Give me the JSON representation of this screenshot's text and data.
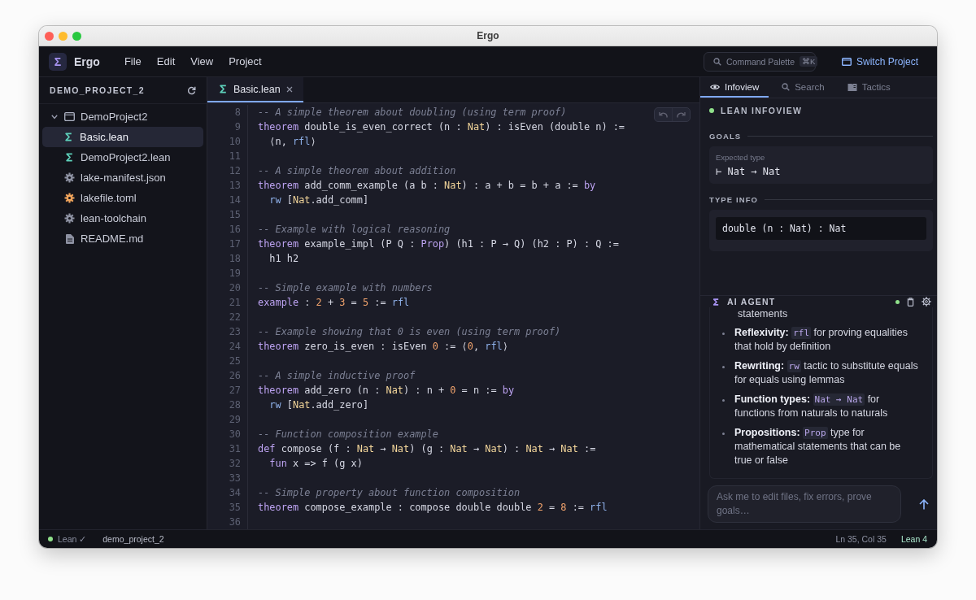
{
  "window": {
    "title": "Ergo"
  },
  "app_bar": {
    "logo": "Σ",
    "app_name": "Ergo",
    "menu": [
      "File",
      "Edit",
      "View",
      "Project"
    ],
    "command_palette": {
      "placeholder": "Command Palette",
      "shortcut": "⌘K"
    },
    "switch_project": "Switch Project"
  },
  "explorer": {
    "title": "DEMO_PROJECT_2",
    "items": [
      {
        "label": "DemoProject2",
        "kind": "folder",
        "expanded": true,
        "selected": false,
        "children": [
          {
            "label": "Basic.lean",
            "kind": "lean",
            "selected": true
          }
        ]
      },
      {
        "label": "DemoProject2.lean",
        "kind": "lean",
        "selected": false
      },
      {
        "label": "lake-manifest.json",
        "kind": "config",
        "selected": false
      },
      {
        "label": "lakefile.toml",
        "kind": "toml",
        "selected": false
      },
      {
        "label": "lean-toolchain",
        "kind": "config",
        "selected": false
      },
      {
        "label": "README.md",
        "kind": "document",
        "selected": false
      }
    ]
  },
  "editor": {
    "tabs": [
      {
        "label": "Basic.lean",
        "selected": true
      }
    ],
    "undo": {
      "disabled": true
    },
    "redo": {
      "disabled": true
    },
    "lines": [
      {
        "number": "8",
        "indented": false,
        "tokens": [
          {
            "kind": "comment",
            "text": "-- A simple theorem about doubling (using term proof)"
          }
        ]
      },
      {
        "number": "9",
        "indented": false,
        "tokens": [
          {
            "kind": "keyword",
            "text": "theorem"
          },
          {
            "kind": "plain",
            "text": " double_is_even_correct (n : "
          },
          {
            "kind": "type",
            "text": "Nat"
          },
          {
            "kind": "plain",
            "text": ") : isEven (double n) :="
          }
        ]
      },
      {
        "number": "10",
        "indented": true,
        "tokens": [
          {
            "kind": "plain",
            "text": "⟨n, "
          },
          {
            "kind": "tactic",
            "text": "rfl"
          },
          {
            "kind": "plain",
            "text": "⟩"
          }
        ]
      },
      {
        "number": "11"
      },
      {
        "number": "12",
        "indented": false,
        "tokens": [
          {
            "kind": "comment",
            "text": "-- A simple theorem about addition"
          }
        ]
      },
      {
        "number": "13",
        "indented": false,
        "tokens": [
          {
            "kind": "keyword",
            "text": "theorem"
          },
          {
            "kind": "plain",
            "text": " add_comm_example (a b : "
          },
          {
            "kind": "type",
            "text": "Nat"
          },
          {
            "kind": "plain",
            "text": ") : a + b = b + a := "
          },
          {
            "kind": "keyword",
            "text": "by"
          }
        ]
      },
      {
        "number": "14",
        "indented": true,
        "tokens": [
          {
            "kind": "tactic",
            "text": "rw"
          },
          {
            "kind": "plain",
            "text": " ["
          },
          {
            "kind": "type",
            "text": "Nat"
          },
          {
            "kind": "plain",
            "text": ".add_comm]"
          }
        ]
      },
      {
        "number": "15"
      },
      {
        "number": "16",
        "indented": false,
        "tokens": [
          {
            "kind": "comment",
            "text": "-- Example with logical reasoning"
          }
        ]
      },
      {
        "number": "17",
        "indented": false,
        "tokens": [
          {
            "kind": "keyword",
            "text": "theorem"
          },
          {
            "kind": "plain",
            "text": " example_impl (P Q : "
          },
          {
            "kind": "keyword",
            "text": "Prop"
          },
          {
            "kind": "plain",
            "text": ") (h1 : P → Q) (h2 : P) : Q :="
          }
        ]
      },
      {
        "number": "18",
        "indented": true,
        "tokens": [
          {
            "kind": "plain",
            "text": "h1 h2"
          }
        ]
      },
      {
        "number": "19"
      },
      {
        "number": "20",
        "indented": false,
        "tokens": [
          {
            "kind": "comment",
            "text": "-- Simple example with numbers"
          }
        ]
      },
      {
        "number": "21",
        "indented": false,
        "tokens": [
          {
            "kind": "keyword",
            "text": "example"
          },
          {
            "kind": "plain",
            "text": " : "
          },
          {
            "kind": "number",
            "text": "2"
          },
          {
            "kind": "plain",
            "text": " + "
          },
          {
            "kind": "number",
            "text": "3"
          },
          {
            "kind": "plain",
            "text": " = "
          },
          {
            "kind": "number",
            "text": "5"
          },
          {
            "kind": "plain",
            "text": " := "
          },
          {
            "kind": "tactic",
            "text": "rfl"
          }
        ]
      },
      {
        "number": "22"
      },
      {
        "number": "23",
        "indented": false,
        "tokens": [
          {
            "kind": "comment",
            "text": "-- Example showing that 0 is even (using term proof)"
          }
        ]
      },
      {
        "number": "24",
        "indented": false,
        "tokens": [
          {
            "kind": "keyword",
            "text": "theorem"
          },
          {
            "kind": "plain",
            "text": " zero_is_even : isEven "
          },
          {
            "kind": "number",
            "text": "0"
          },
          {
            "kind": "plain",
            "text": " := ⟨"
          },
          {
            "kind": "number",
            "text": "0"
          },
          {
            "kind": "plain",
            "text": ", "
          },
          {
            "kind": "tactic",
            "text": "rfl"
          },
          {
            "kind": "plain",
            "text": "⟩"
          }
        ]
      },
      {
        "number": "25"
      },
      {
        "number": "26",
        "indented": false,
        "tokens": [
          {
            "kind": "comment",
            "text": "-- A simple inductive proof"
          }
        ]
      },
      {
        "number": "27",
        "indented": false,
        "tokens": [
          {
            "kind": "keyword",
            "text": "theorem"
          },
          {
            "kind": "plain",
            "text": " add_zero (n : "
          },
          {
            "kind": "type",
            "text": "Nat"
          },
          {
            "kind": "plain",
            "text": ") : n + "
          },
          {
            "kind": "number",
            "text": "0"
          },
          {
            "kind": "plain",
            "text": " = n := "
          },
          {
            "kind": "keyword",
            "text": "by"
          }
        ]
      },
      {
        "number": "28",
        "indented": true,
        "tokens": [
          {
            "kind": "tactic",
            "text": "rw"
          },
          {
            "kind": "plain",
            "text": " ["
          },
          {
            "kind": "type",
            "text": "Nat"
          },
          {
            "kind": "plain",
            "text": ".add_zero]"
          }
        ]
      },
      {
        "number": "29"
      },
      {
        "number": "30",
        "indented": false,
        "tokens": [
          {
            "kind": "comment",
            "text": "-- Function composition example"
          }
        ]
      },
      {
        "number": "31",
        "indented": false,
        "tokens": [
          {
            "kind": "keyword",
            "text": "def"
          },
          {
            "kind": "plain",
            "text": " compose (f : "
          },
          {
            "kind": "type",
            "text": "Nat"
          },
          {
            "kind": "plain",
            "text": " → "
          },
          {
            "kind": "type",
            "text": "Nat"
          },
          {
            "kind": "plain",
            "text": ") (g : "
          },
          {
            "kind": "type",
            "text": "Nat"
          },
          {
            "kind": "plain",
            "text": " → "
          },
          {
            "kind": "type",
            "text": "Nat"
          },
          {
            "kind": "plain",
            "text": ") : "
          },
          {
            "kind": "type",
            "text": "Nat"
          },
          {
            "kind": "plain",
            "text": " → "
          },
          {
            "kind": "type",
            "text": "Nat"
          },
          {
            "kind": "plain",
            "text": " :="
          }
        ]
      },
      {
        "number": "32",
        "indented": true,
        "tokens": [
          {
            "kind": "keyword",
            "text": "fun"
          },
          {
            "kind": "plain",
            "text": " x => f (g x)"
          }
        ]
      },
      {
        "number": "33"
      },
      {
        "number": "34",
        "indented": false,
        "tokens": [
          {
            "kind": "comment",
            "text": "-- Simple property about function composition"
          }
        ]
      },
      {
        "number": "35",
        "indented": false,
        "tokens": [
          {
            "kind": "keyword",
            "text": "theorem"
          },
          {
            "kind": "plain",
            "text": " compose_example : compose double double "
          },
          {
            "kind": "number",
            "text": "2"
          },
          {
            "kind": "plain",
            "text": " = "
          },
          {
            "kind": "number",
            "text": "8"
          },
          {
            "kind": "plain",
            "text": " := "
          },
          {
            "kind": "tactic",
            "text": "rfl"
          }
        ]
      },
      {
        "number": "36"
      }
    ]
  },
  "infoview": {
    "tabs": [
      {
        "label": "Infoview",
        "selected": true
      },
      {
        "label": "Search",
        "selected": false
      },
      {
        "label": "Tactics",
        "selected": false
      }
    ],
    "title": "LEAN INFOVIEW",
    "connected": true,
    "goals": {
      "heading": "GOALS",
      "label": "Expected type",
      "goal": "⊢ Nat → Nat"
    },
    "type_info": {
      "heading": "TYPE INFO",
      "value": "double (n : Nat) : Nat"
    }
  },
  "ai_agent": {
    "title": "AI AGENT",
    "online": true,
    "message_start": "statements",
    "bullets": [
      {
        "term": "Reflexivity:",
        "code": "rfl",
        "text": "for proving equalities that hold by definition"
      },
      {
        "term": "Rewriting:",
        "code": "rw",
        "text": "tactic to substitute equals for equals using lemmas"
      },
      {
        "term": "Function types:",
        "code": "Nat → Nat",
        "text": "for functions from naturals to naturals"
      },
      {
        "term": "Propositions:",
        "code": "Prop",
        "text": "type for mathematical statements that can be true or false"
      }
    ],
    "input": {
      "placeholder": "Ask me to edit files, fix errors, prove goals…"
    }
  },
  "status_bar": {
    "lean": {
      "label": "Lean ✓",
      "ok": true
    },
    "project": "demo_project_2",
    "cursor": "Ln 35, Col 35",
    "language": "Lean 4"
  }
}
